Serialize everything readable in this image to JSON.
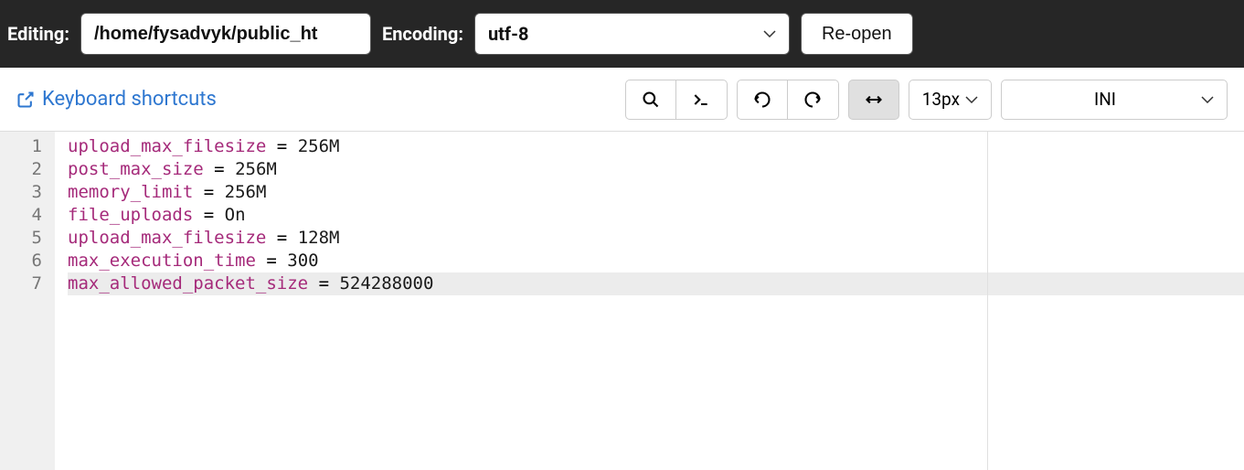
{
  "topbar": {
    "editing_label": "Editing:",
    "path_value": "/home/fysadvyk/public_ht",
    "encoding_label": "Encoding:",
    "encoding_value": "utf-8",
    "reopen_label": "Re-open"
  },
  "toolbar": {
    "keyboard_shortcuts": "Keyboard shortcuts",
    "font_size": "13px",
    "language": "INI"
  },
  "code": {
    "lines": [
      {
        "key": "upload_max_filesize",
        "value": "256M"
      },
      {
        "key": "post_max_size",
        "value": "256M"
      },
      {
        "key": "memory_limit",
        "value": "256M"
      },
      {
        "key": "file_uploads",
        "value": "On"
      },
      {
        "key": "upload_max_filesize",
        "value": "128M"
      },
      {
        "key": "max_execution_time",
        "value": "300"
      },
      {
        "key": "max_allowed_packet_size",
        "value": "524288000"
      }
    ],
    "active_line": 7
  }
}
